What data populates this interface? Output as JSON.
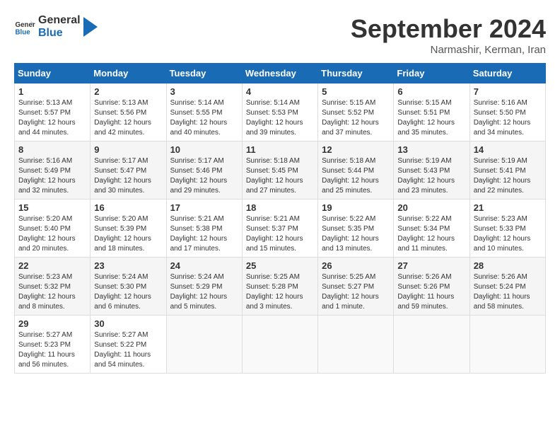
{
  "logo": {
    "line1": "General",
    "line2": "Blue"
  },
  "title": "September 2024",
  "location": "Narmashir, Kerman, Iran",
  "days_header": [
    "Sunday",
    "Monday",
    "Tuesday",
    "Wednesday",
    "Thursday",
    "Friday",
    "Saturday"
  ],
  "weeks": [
    [
      {
        "day": "1",
        "sunrise": "5:13 AM",
        "sunset": "5:57 PM",
        "daylight": "12 hours and 44 minutes."
      },
      {
        "day": "2",
        "sunrise": "5:13 AM",
        "sunset": "5:56 PM",
        "daylight": "12 hours and 42 minutes."
      },
      {
        "day": "3",
        "sunrise": "5:14 AM",
        "sunset": "5:55 PM",
        "daylight": "12 hours and 40 minutes."
      },
      {
        "day": "4",
        "sunrise": "5:14 AM",
        "sunset": "5:53 PM",
        "daylight": "12 hours and 39 minutes."
      },
      {
        "day": "5",
        "sunrise": "5:15 AM",
        "sunset": "5:52 PM",
        "daylight": "12 hours and 37 minutes."
      },
      {
        "day": "6",
        "sunrise": "5:15 AM",
        "sunset": "5:51 PM",
        "daylight": "12 hours and 35 minutes."
      },
      {
        "day": "7",
        "sunrise": "5:16 AM",
        "sunset": "5:50 PM",
        "daylight": "12 hours and 34 minutes."
      }
    ],
    [
      {
        "day": "8",
        "sunrise": "5:16 AM",
        "sunset": "5:49 PM",
        "daylight": "12 hours and 32 minutes."
      },
      {
        "day": "9",
        "sunrise": "5:17 AM",
        "sunset": "5:47 PM",
        "daylight": "12 hours and 30 minutes."
      },
      {
        "day": "10",
        "sunrise": "5:17 AM",
        "sunset": "5:46 PM",
        "daylight": "12 hours and 29 minutes."
      },
      {
        "day": "11",
        "sunrise": "5:18 AM",
        "sunset": "5:45 PM",
        "daylight": "12 hours and 27 minutes."
      },
      {
        "day": "12",
        "sunrise": "5:18 AM",
        "sunset": "5:44 PM",
        "daylight": "12 hours and 25 minutes."
      },
      {
        "day": "13",
        "sunrise": "5:19 AM",
        "sunset": "5:43 PM",
        "daylight": "12 hours and 23 minutes."
      },
      {
        "day": "14",
        "sunrise": "5:19 AM",
        "sunset": "5:41 PM",
        "daylight": "12 hours and 22 minutes."
      }
    ],
    [
      {
        "day": "15",
        "sunrise": "5:20 AM",
        "sunset": "5:40 PM",
        "daylight": "12 hours and 20 minutes."
      },
      {
        "day": "16",
        "sunrise": "5:20 AM",
        "sunset": "5:39 PM",
        "daylight": "12 hours and 18 minutes."
      },
      {
        "day": "17",
        "sunrise": "5:21 AM",
        "sunset": "5:38 PM",
        "daylight": "12 hours and 17 minutes."
      },
      {
        "day": "18",
        "sunrise": "5:21 AM",
        "sunset": "5:37 PM",
        "daylight": "12 hours and 15 minutes."
      },
      {
        "day": "19",
        "sunrise": "5:22 AM",
        "sunset": "5:35 PM",
        "daylight": "12 hours and 13 minutes."
      },
      {
        "day": "20",
        "sunrise": "5:22 AM",
        "sunset": "5:34 PM",
        "daylight": "12 hours and 11 minutes."
      },
      {
        "day": "21",
        "sunrise": "5:23 AM",
        "sunset": "5:33 PM",
        "daylight": "12 hours and 10 minutes."
      }
    ],
    [
      {
        "day": "22",
        "sunrise": "5:23 AM",
        "sunset": "5:32 PM",
        "daylight": "12 hours and 8 minutes."
      },
      {
        "day": "23",
        "sunrise": "5:24 AM",
        "sunset": "5:30 PM",
        "daylight": "12 hours and 6 minutes."
      },
      {
        "day": "24",
        "sunrise": "5:24 AM",
        "sunset": "5:29 PM",
        "daylight": "12 hours and 5 minutes."
      },
      {
        "day": "25",
        "sunrise": "5:25 AM",
        "sunset": "5:28 PM",
        "daylight": "12 hours and 3 minutes."
      },
      {
        "day": "26",
        "sunrise": "5:25 AM",
        "sunset": "5:27 PM",
        "daylight": "12 hours and 1 minute."
      },
      {
        "day": "27",
        "sunrise": "5:26 AM",
        "sunset": "5:26 PM",
        "daylight": "11 hours and 59 minutes."
      },
      {
        "day": "28",
        "sunrise": "5:26 AM",
        "sunset": "5:24 PM",
        "daylight": "11 hours and 58 minutes."
      }
    ],
    [
      {
        "day": "29",
        "sunrise": "5:27 AM",
        "sunset": "5:23 PM",
        "daylight": "11 hours and 56 minutes."
      },
      {
        "day": "30",
        "sunrise": "5:27 AM",
        "sunset": "5:22 PM",
        "daylight": "11 hours and 54 minutes."
      },
      null,
      null,
      null,
      null,
      null
    ]
  ]
}
